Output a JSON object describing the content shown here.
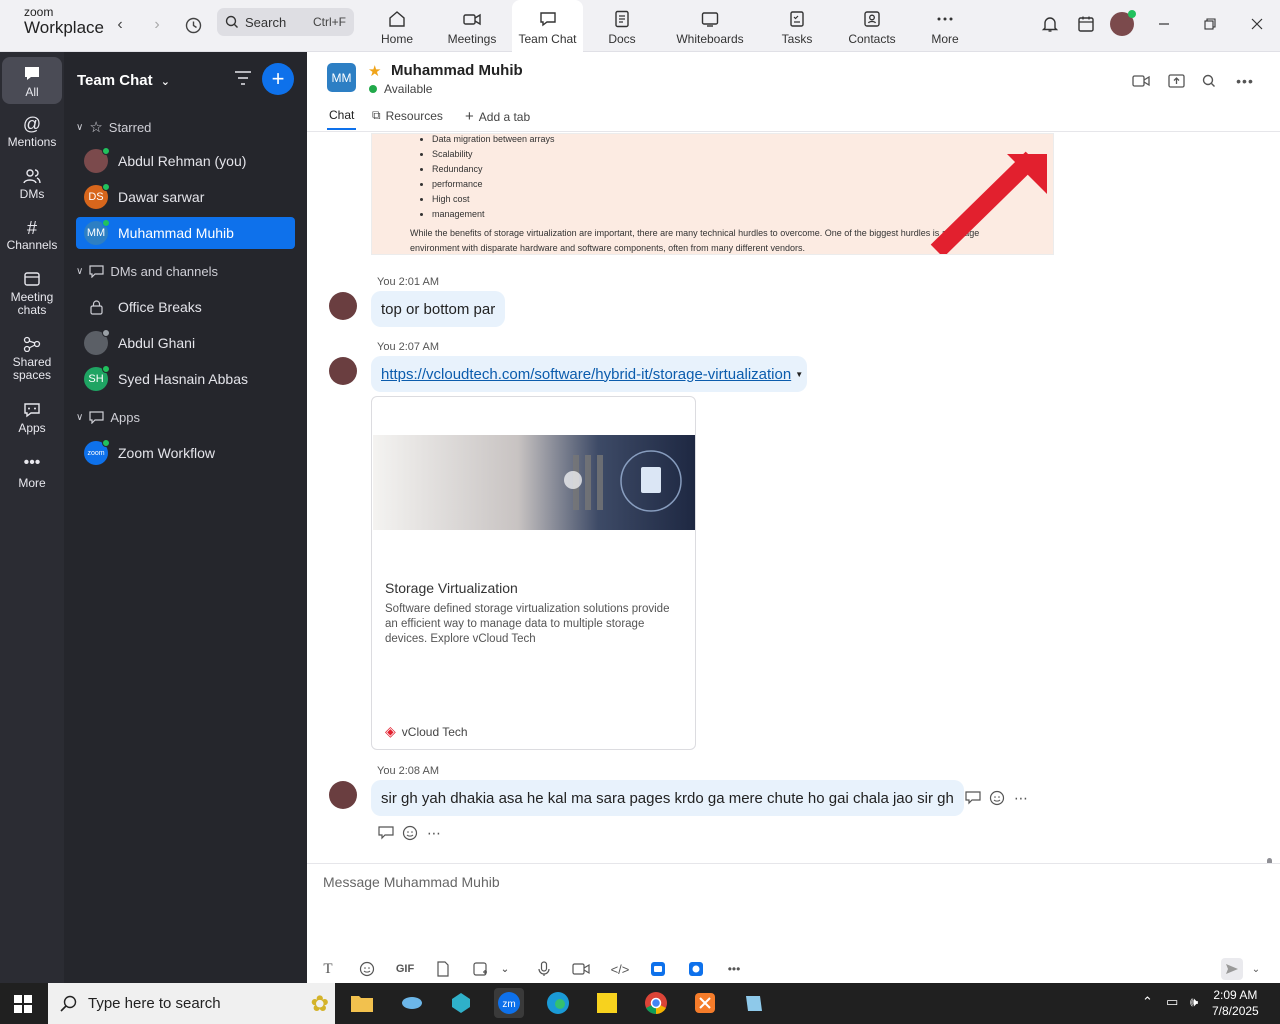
{
  "brand": {
    "line1": "zoom",
    "line2": "Workplace"
  },
  "search": {
    "label": "Search",
    "shortcut": "Ctrl+F"
  },
  "tabs": [
    {
      "label": "Home"
    },
    {
      "label": "Meetings"
    },
    {
      "label": "Team Chat"
    },
    {
      "label": "Docs"
    },
    {
      "label": "Whiteboards"
    },
    {
      "label": "Tasks"
    },
    {
      "label": "Contacts"
    },
    {
      "label": "More"
    }
  ],
  "rail": [
    {
      "label": "All"
    },
    {
      "label": "Mentions"
    },
    {
      "label": "DMs"
    },
    {
      "label": "Channels"
    },
    {
      "label": "Meeting chats"
    },
    {
      "label": "Shared spaces"
    },
    {
      "label": "Apps"
    },
    {
      "label": "More"
    }
  ],
  "sidebar": {
    "title": "Team Chat",
    "starred_label": "Starred",
    "starred": [
      {
        "name": "Abdul Rehman (you)"
      },
      {
        "name": "Dawar sarwar",
        "initials": "DS"
      },
      {
        "name": "Muhammad Muhib",
        "initials": "MM"
      }
    ],
    "dms_label": "DMs and channels",
    "dms": [
      {
        "name": "Office Breaks"
      },
      {
        "name": "Abdul Ghani"
      },
      {
        "name": "Syed Hasnain Abbas",
        "initials": "SH"
      }
    ],
    "apps_label": "Apps",
    "apps": [
      {
        "name": "Zoom Workflow",
        "initials": "zoom"
      }
    ]
  },
  "chat": {
    "initials": "MM",
    "name": "Muhammad Muhib",
    "status": "Available",
    "tabs": {
      "chat": "Chat",
      "resources": "Resources",
      "add": "Add a tab"
    },
    "image_text": {
      "bullets": [
        "Data migration between arrays",
        "Scalability",
        "Redundancy",
        "performance",
        "High cost",
        "management"
      ],
      "paragraph": "While the benefits of storage virtualization are important, there are many technical hurdles to overcome. One of the biggest hurdles is a storage environment with disparate hardware and software components, often from many different vendors."
    },
    "messages": [
      {
        "time": "You 2:01 AM",
        "text": "top or bottom par"
      },
      {
        "time": "You 2:07 AM",
        "link": "https://vcloudtech.com/software/hybrid-it/storage-virtualization"
      },
      {
        "time": "You 2:08 AM",
        "text": "sir gh yah dhakia asa he kal ma sara pages krdo ga mere chute ho gai chala jao sir gh"
      }
    ],
    "link_preview": {
      "title": "Storage Virtualization",
      "description": "Software defined storage virtualization solutions provide an efficient way to manage data to multiple storage devices. Explore vCloud Tech",
      "source": "vCloud Tech"
    },
    "compose": {
      "placeholder": "Message Muhammad Muhib",
      "gif": "GIF"
    }
  },
  "taskbar": {
    "search": "Type here to search",
    "time": "2:09 AM",
    "date": "7/8/2025"
  },
  "colors": {
    "accent": "#0e71eb",
    "sidebar": "#25262c",
    "rail": "#2b2c33",
    "bubble": "#e8f2fc"
  }
}
